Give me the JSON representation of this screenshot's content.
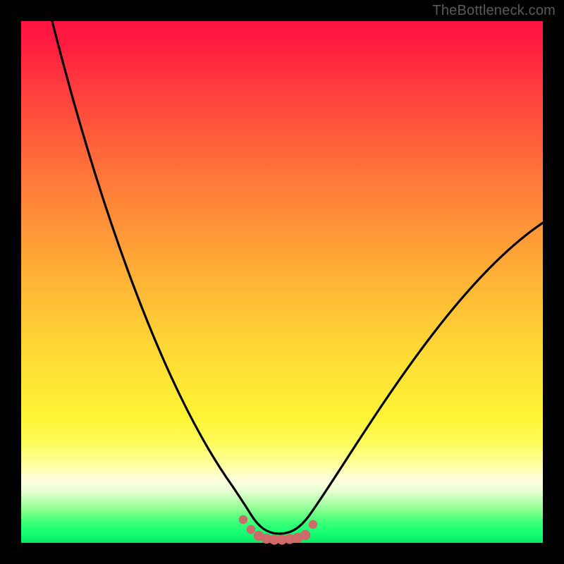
{
  "watermark": {
    "text": "TheBottleneck.com"
  },
  "colors": {
    "black": "#000000",
    "curve": "#000000",
    "marker": "#d06a6a",
    "marker_stroke": "#c55f5f"
  },
  "chart_data": {
    "type": "line",
    "title": "",
    "xlabel": "",
    "ylabel": "",
    "xlim": [
      0,
      100
    ],
    "ylim": [
      0,
      100
    ],
    "grid": false,
    "legend": null,
    "series": [
      {
        "name": "bottleneck-curve",
        "x": [
          6,
          10,
          15,
          20,
          25,
          30,
          35,
          40,
          42,
          44,
          46,
          48,
          50,
          52,
          55,
          60,
          65,
          70,
          75,
          80,
          85,
          90,
          95,
          100
        ],
        "values": [
          100,
          87,
          73,
          61,
          49,
          38,
          27,
          15,
          9,
          4,
          1,
          0,
          0,
          0,
          1,
          5,
          11,
          18,
          25,
          32,
          40,
          47,
          54,
          61
        ]
      }
    ],
    "markers": {
      "name": "flat-bottom-dots",
      "x": [
        42.5,
        44,
        45.5,
        47,
        48.5,
        50,
        51.5,
        53,
        54.5,
        56
      ],
      "values": [
        4.5,
        2.5,
        1.3,
        0.8,
        0.6,
        0.6,
        0.7,
        0.9,
        1.5,
        3.5
      ]
    },
    "annotations": []
  }
}
